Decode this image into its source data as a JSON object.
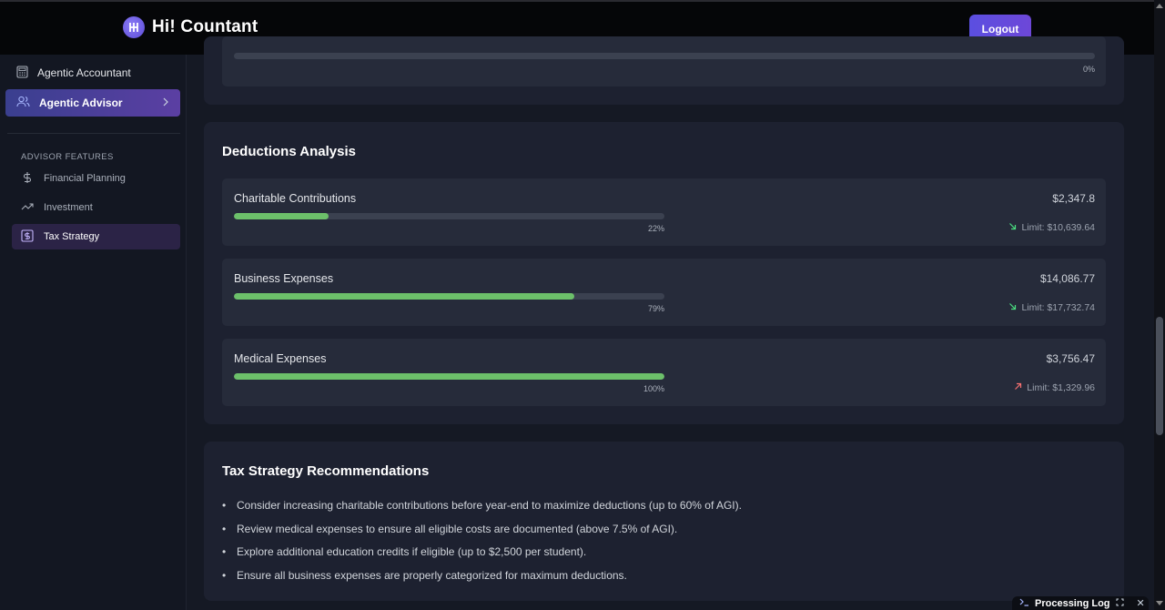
{
  "header": {
    "app_title": "Hi! Countant",
    "logout_label": "Logout"
  },
  "sidebar": {
    "items": [
      {
        "label": "Agentic Accountant",
        "icon": "calculator-icon"
      },
      {
        "label": "Agentic Advisor",
        "icon": "users-icon",
        "active": true
      }
    ],
    "section_title": "ADVISOR FEATURES",
    "sub_items": [
      {
        "label": "Financial Planning",
        "icon": "dollar-icon"
      },
      {
        "label": "Investment",
        "icon": "trending-up-icon"
      },
      {
        "label": "Tax Strategy",
        "icon": "dollar-square-icon",
        "active": true
      }
    ]
  },
  "previous_card": {
    "progress_pct": "0%"
  },
  "deductions": {
    "title": "Deductions Analysis",
    "items": [
      {
        "name": "Charitable Contributions",
        "amount": "$2,347.8",
        "pct_label": "22%",
        "progress": 0.22,
        "limit": "Limit: $10,639.64",
        "trend": "down",
        "trend_color": "#4ade80"
      },
      {
        "name": "Business Expenses",
        "amount": "$14,086.77",
        "pct_label": "79%",
        "progress": 0.79,
        "limit": "Limit: $17,732.74",
        "trend": "down",
        "trend_color": "#4ade80"
      },
      {
        "name": "Medical Expenses",
        "amount": "$3,756.47",
        "pct_label": "100%",
        "progress": 1.0,
        "limit": "Limit: $1,329.96",
        "trend": "up",
        "trend_color": "#f87171"
      }
    ]
  },
  "recommendations": {
    "title": "Tax Strategy Recommendations",
    "items": [
      "Consider increasing charitable contributions before year-end to maximize deductions (up to 60% of AGI).",
      "Review medical expenses to ensure all eligible costs are documented (above 7.5% of AGI).",
      "Explore additional education credits if eligible (up to $2,500 per student).",
      "Ensure all business expenses are properly categorized for maximum deductions."
    ]
  },
  "processing_log": {
    "label": "Processing Log"
  },
  "colors": {
    "accent": "#5b4fe0",
    "progress_fill": "#6cc06a"
  }
}
